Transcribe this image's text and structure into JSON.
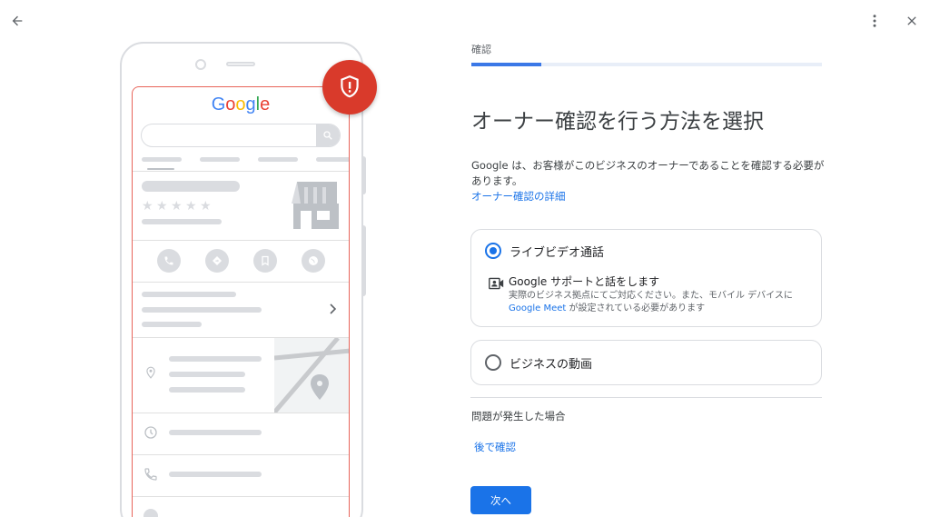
{
  "toolbar": {
    "back_icon": "arrow-back-icon",
    "more_icon": "more-vert-icon",
    "close_icon": "close-icon"
  },
  "illustration": {
    "logo_text": "Google",
    "badge_icon": "shield-alert-icon",
    "accent_color": "#d93a2b"
  },
  "step": {
    "label": "確認",
    "progress_fraction": 0.2
  },
  "main": {
    "title": "オーナー確認を行う方法を選択",
    "description": "Google は、お客様がこのビジネスのオーナーであることを確認する必要があります。",
    "details_link": "オーナー確認の詳細"
  },
  "options": [
    {
      "label": "ライブビデオ通話",
      "selected": true,
      "sub_icon": "video-call-icon",
      "sub_title": "Google サポートと話をします",
      "sub_text": "実際のビジネス拠点にてご対応ください。また、モバイル デバイスに",
      "sub_link": "Google Meet",
      "sub_text_after": " が設定されている必要があります"
    },
    {
      "label": "ビジネスの動画",
      "selected": false
    }
  ],
  "footer": {
    "trouble_label": "問題が発生した場合",
    "later_link": "後で確認",
    "next_button": "次へ"
  },
  "colors": {
    "primary": "#1a73e8",
    "progress_track": "#e8eef8",
    "border": "#dadce0"
  }
}
